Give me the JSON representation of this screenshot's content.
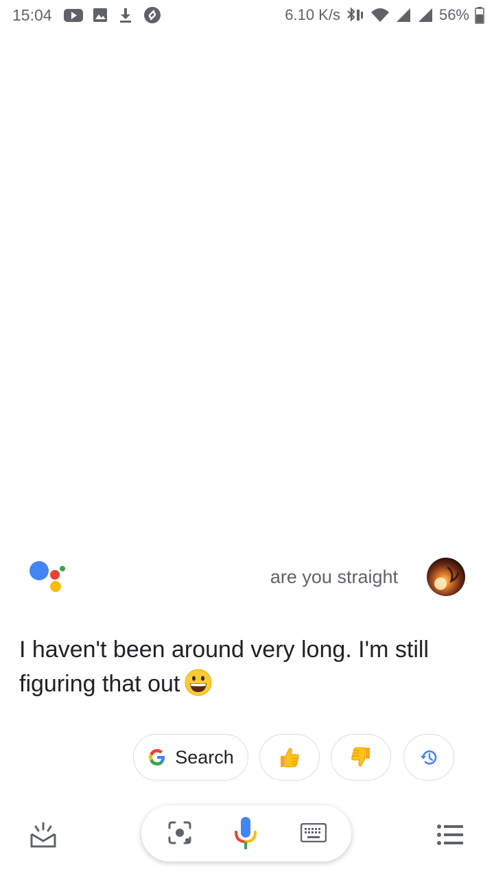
{
  "status_bar": {
    "time": "15:04",
    "network_speed": "6.10 K/s",
    "battery": "56%",
    "icons": [
      "youtube-icon",
      "gallery-icon",
      "download-icon",
      "shazam-icon",
      "bluetooth-vibrate-icon",
      "wifi-icon",
      "signal-icon",
      "signal-icon",
      "battery-icon"
    ]
  },
  "conversation": {
    "user_query": "are you straight",
    "assistant_reply": "I haven't been around very long. I'm still figuring that out"
  },
  "chips": {
    "search_label": "Search"
  },
  "colors": {
    "google_blue": "#4285F4",
    "google_red": "#EA4335",
    "google_yellow": "#FBBC05",
    "google_green": "#34A853"
  }
}
